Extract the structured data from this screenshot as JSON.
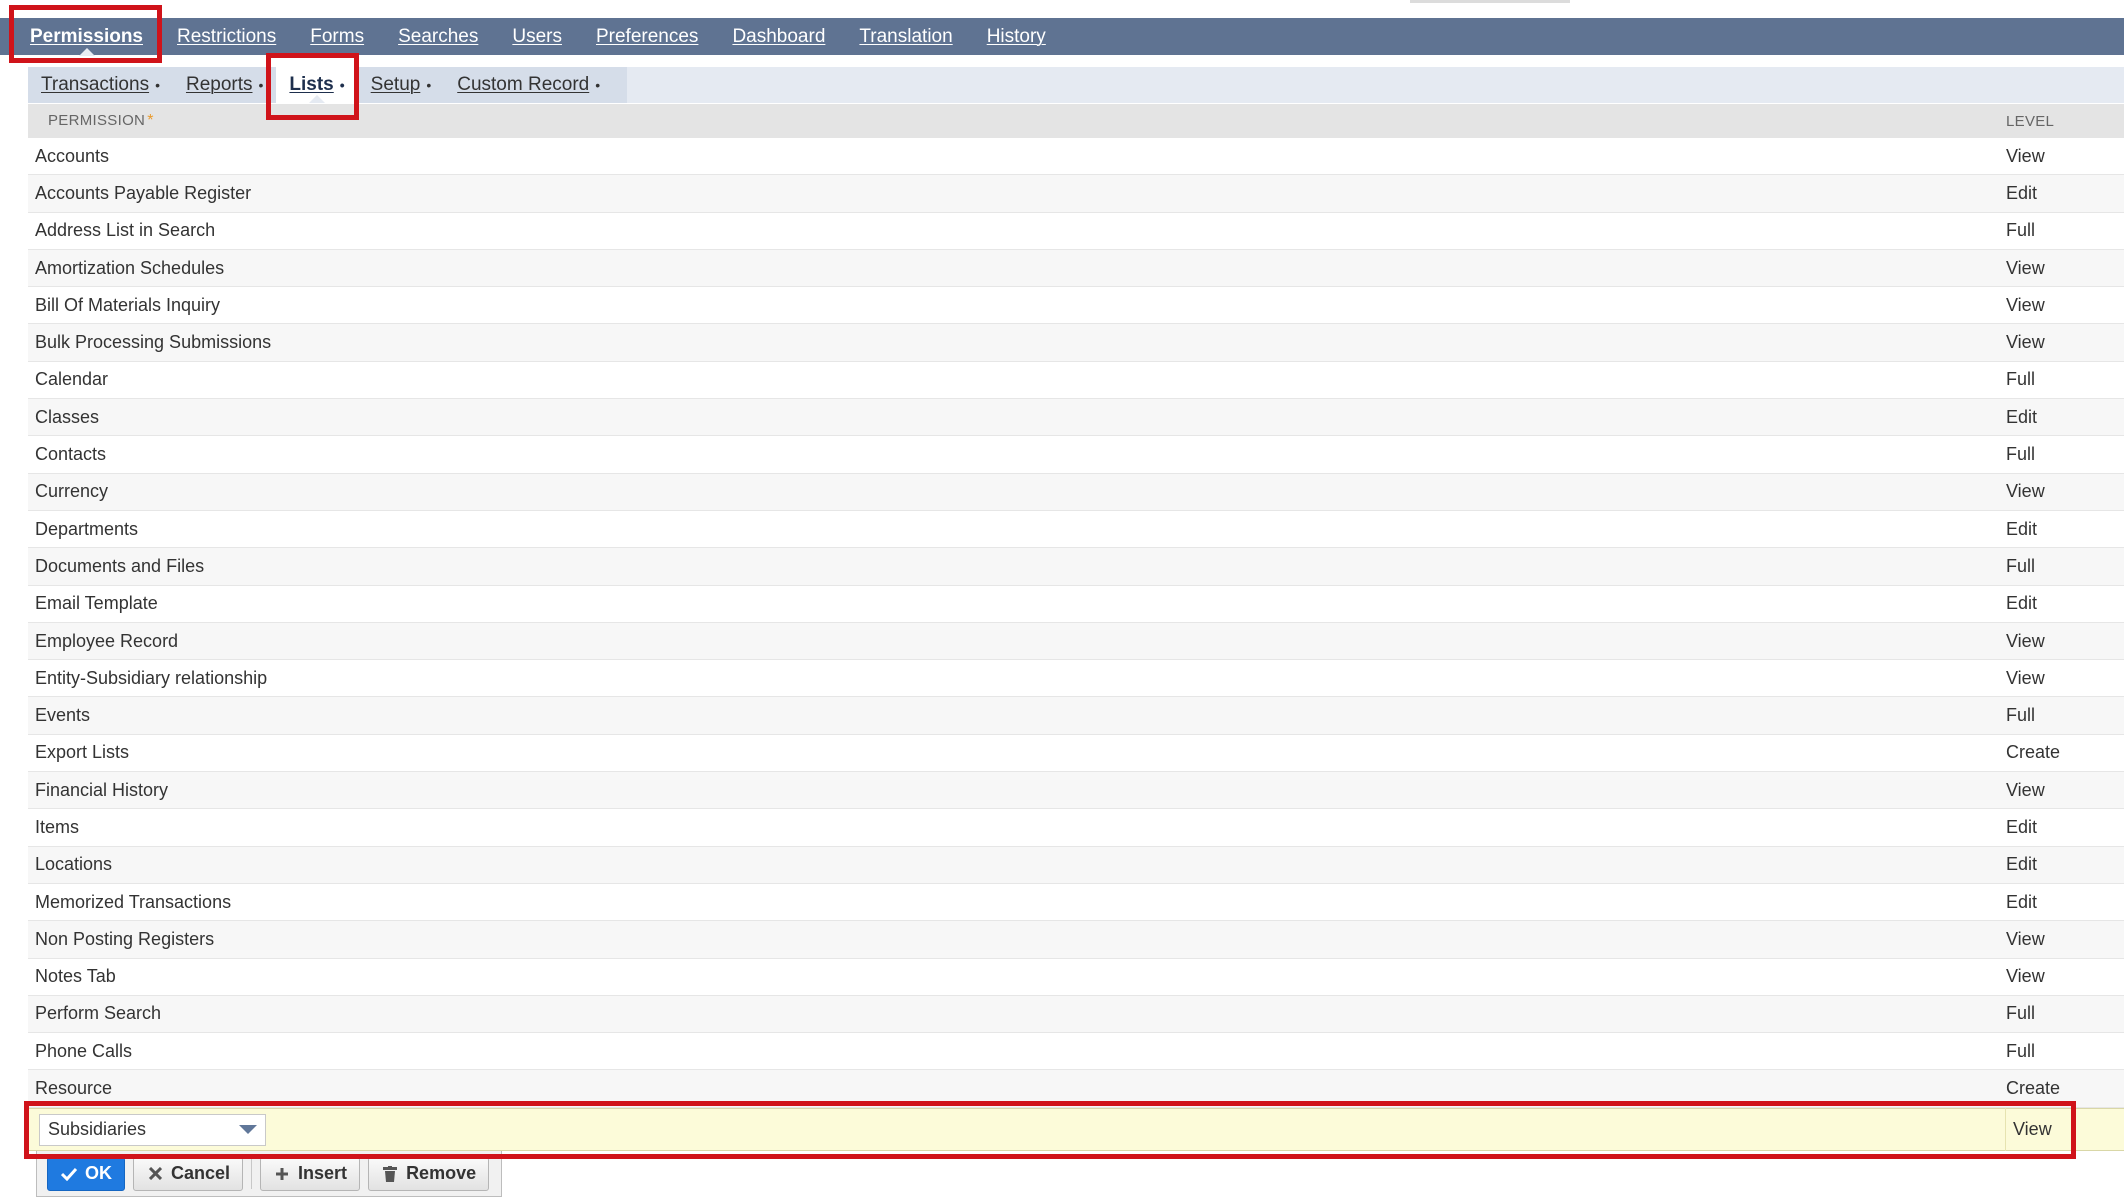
{
  "main_tabs": [
    {
      "label": "Permissions",
      "active": true
    },
    {
      "label": "Restrictions",
      "active": false
    },
    {
      "label": "Forms",
      "active": false
    },
    {
      "label": "Searches",
      "active": false
    },
    {
      "label": "Users",
      "active": false
    },
    {
      "label": "Preferences",
      "active": false
    },
    {
      "label": "Dashboard",
      "active": false
    },
    {
      "label": "Translation",
      "active": false
    },
    {
      "label": "History",
      "active": false
    }
  ],
  "sub_tabs": [
    {
      "label": "Transactions",
      "dot": "•",
      "active": false
    },
    {
      "label": "Reports",
      "dot": "•",
      "active": false
    },
    {
      "label": "Lists",
      "dot": "•",
      "active": true
    },
    {
      "label": "Setup",
      "dot": "•",
      "active": false
    },
    {
      "label": "Custom Record",
      "dot": "•",
      "active": false
    }
  ],
  "table": {
    "header_permission": "PERMISSION",
    "required_marker": "*",
    "header_level": "LEVEL",
    "rows": [
      {
        "permission": "Accounts",
        "level": "View"
      },
      {
        "permission": "Accounts Payable Register",
        "level": "Edit"
      },
      {
        "permission": "Address List in Search",
        "level": "Full"
      },
      {
        "permission": "Amortization Schedules",
        "level": "View"
      },
      {
        "permission": "Bill Of Materials Inquiry",
        "level": "View"
      },
      {
        "permission": "Bulk Processing Submissions",
        "level": "View"
      },
      {
        "permission": "Calendar",
        "level": "Full"
      },
      {
        "permission": "Classes",
        "level": "Edit"
      },
      {
        "permission": "Contacts",
        "level": "Full"
      },
      {
        "permission": "Currency",
        "level": "View"
      },
      {
        "permission": "Departments",
        "level": "Edit"
      },
      {
        "permission": "Documents and Files",
        "level": "Full"
      },
      {
        "permission": "Email Template",
        "level": "Edit"
      },
      {
        "permission": "Employee Record",
        "level": "View"
      },
      {
        "permission": "Entity-Subsidiary relationship",
        "level": "View"
      },
      {
        "permission": "Events",
        "level": "Full"
      },
      {
        "permission": "Export Lists",
        "level": "Create"
      },
      {
        "permission": "Financial History",
        "level": "View"
      },
      {
        "permission": "Items",
        "level": "Edit"
      },
      {
        "permission": "Locations",
        "level": "Edit"
      },
      {
        "permission": "Memorized Transactions",
        "level": "Edit"
      },
      {
        "permission": "Non Posting Registers",
        "level": "View"
      },
      {
        "permission": "Notes Tab",
        "level": "View"
      },
      {
        "permission": "Perform Search",
        "level": "Full"
      },
      {
        "permission": "Phone Calls",
        "level": "Full"
      },
      {
        "permission": "Resource",
        "level": "Create"
      }
    ]
  },
  "edit_row": {
    "selected_permission": "Subsidiaries",
    "level": "View"
  },
  "actions": {
    "ok_label": "OK",
    "cancel_label": "Cancel",
    "insert_label": "Insert",
    "remove_label": "Remove"
  },
  "colors": {
    "tab_bar": "#5f7392",
    "highlight": "#d0131a",
    "edit_row_bg": "#fcfbd9",
    "primary_button": "#1f7ae0"
  }
}
